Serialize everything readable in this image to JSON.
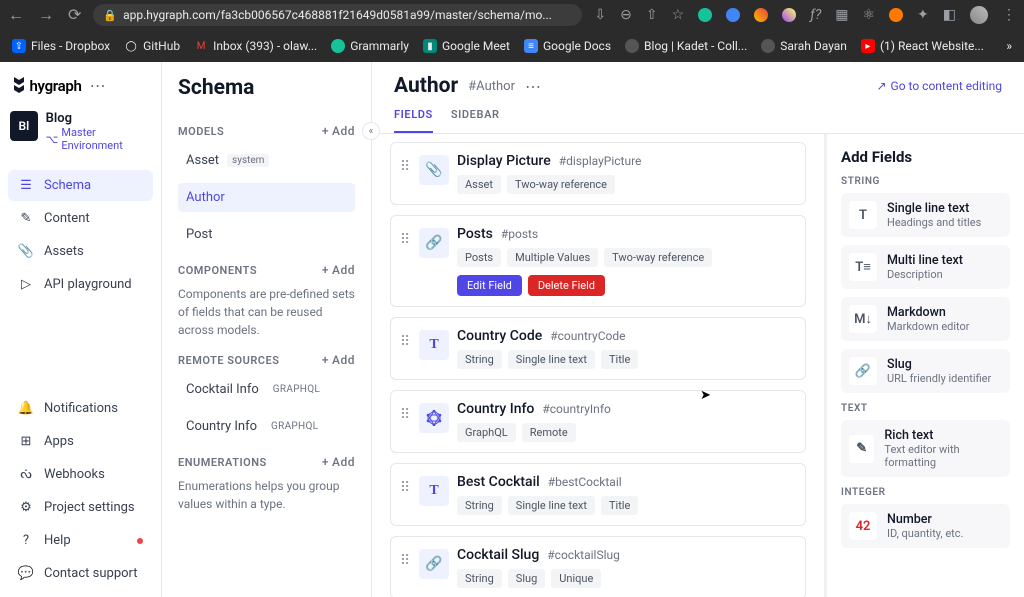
{
  "browser": {
    "url": "app.hygraph.com/fa3cb006567c468881f21649d0581a99/master/schema/mo...",
    "bookmarks": [
      {
        "label": "Files - Dropbox",
        "color": "#0061ff"
      },
      {
        "label": "GitHub",
        "color": "#ffffff"
      },
      {
        "label": "Inbox (393) - olaw...",
        "color": "#ea4335"
      },
      {
        "label": "Grammarly",
        "color": "#15c39a"
      },
      {
        "label": "Google Meet",
        "color": "#00897b"
      },
      {
        "label": "Google Docs",
        "color": "#4285f4"
      },
      {
        "label": "Blog | Kadet - Coll...",
        "color": "#888"
      },
      {
        "label": "Sarah Dayan",
        "color": "#888"
      },
      {
        "label": "(1) React Website...",
        "color": "#ff0000"
      }
    ]
  },
  "logo_text": "hygraph",
  "project": {
    "initials": "Bl",
    "name": "Blog",
    "env": "Master Environment"
  },
  "nav": {
    "schema": "Schema",
    "content": "Content",
    "assets": "Assets",
    "api": "API playground",
    "notifications": "Notifications",
    "apps": "Apps",
    "webhooks": "Webhooks",
    "settings": "Project settings",
    "help": "Help",
    "support": "Contact support"
  },
  "schema_panel": {
    "title": "Schema",
    "add": "Add",
    "models_label": "MODELS",
    "models": [
      {
        "name": "Asset",
        "system": "system"
      },
      {
        "name": "Author"
      },
      {
        "name": "Post"
      }
    ],
    "components_label": "COMPONENTS",
    "components_desc": "Components are pre-defined sets of fields that can be reused across models.",
    "remote_label": "REMOTE SOURCES",
    "remotes": [
      {
        "name": "Cocktail Info",
        "tag": "GRAPHQL"
      },
      {
        "name": "Country Info",
        "tag": "GRAPHQL"
      }
    ],
    "enum_label": "ENUMERATIONS",
    "enum_desc": "Enumerations helps you group values within a type."
  },
  "main": {
    "title": "Author",
    "api_id": "#Author",
    "edit_link": "Go to content editing",
    "tabs": {
      "fields": "FIELDS",
      "sidebar": "SIDEBAR"
    },
    "fields": [
      {
        "name": "Display Picture",
        "api": "#displayPicture",
        "icon": "clip",
        "pills": [
          "Asset",
          "Two-way reference"
        ]
      },
      {
        "name": "Posts",
        "api": "#posts",
        "icon": "link",
        "pills": [
          "Posts",
          "Multiple Values",
          "Two-way reference"
        ],
        "actions": true,
        "edit": "Edit Field",
        "delete": "Delete Field"
      },
      {
        "name": "Country Code",
        "api": "#countryCode",
        "icon": "T",
        "pills": [
          "String",
          "Single line text",
          "Title"
        ]
      },
      {
        "name": "Country Info",
        "api": "#countryInfo",
        "icon": "gql",
        "pills": [
          "GraphQL",
          "Remote"
        ]
      },
      {
        "name": "Best Cocktail",
        "api": "#bestCocktail",
        "icon": "T",
        "pills": [
          "String",
          "Single line text",
          "Title"
        ]
      },
      {
        "name": "Cocktail Slug",
        "api": "#cocktailSlug",
        "icon": "link2",
        "pills": [
          "String",
          "Slug",
          "Unique"
        ]
      }
    ]
  },
  "add_fields": {
    "title": "Add Fields",
    "string_label": "STRING",
    "text_label": "TEXT",
    "integer_label": "INTEGER",
    "types": {
      "single": {
        "name": "Single line text",
        "desc": "Headings and titles",
        "icon": "T"
      },
      "multi": {
        "name": "Multi line text",
        "desc": "Description",
        "icon": "T≡"
      },
      "markdown": {
        "name": "Markdown",
        "desc": "Markdown editor",
        "icon": "M↓"
      },
      "slug": {
        "name": "Slug",
        "desc": "URL friendly identifier",
        "icon": "🔗"
      },
      "rich": {
        "name": "Rich text",
        "desc": "Text editor with formatting",
        "icon": "✎"
      },
      "number": {
        "name": "Number",
        "desc": "ID, quantity, etc.",
        "icon": "42"
      }
    }
  }
}
